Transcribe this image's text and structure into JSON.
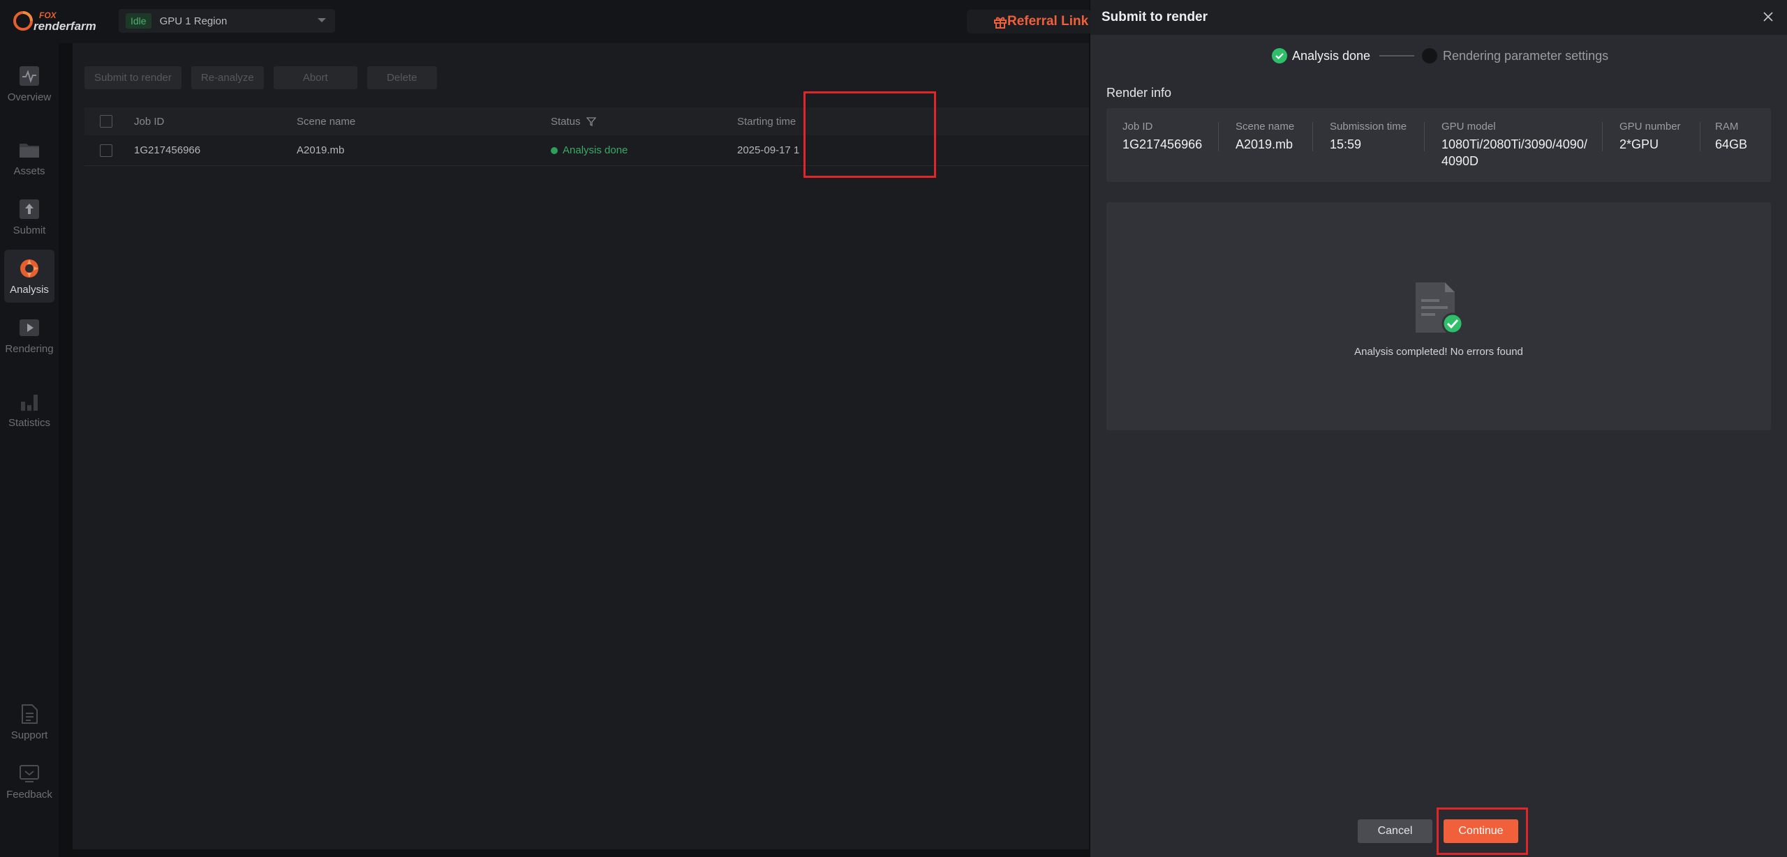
{
  "app": {
    "logo_top": "FOX",
    "logo_bottom": "renderfarm",
    "status_badge": "Idle",
    "region": "GPU 1 Region",
    "referral_label": "Referral Link"
  },
  "nav": {
    "items": [
      {
        "label": "Overview",
        "icon": "activity-icon"
      },
      {
        "label": "Assets",
        "icon": "folder-icon"
      },
      {
        "label": "Submit",
        "icon": "upload-icon"
      },
      {
        "label": "Analysis",
        "icon": "analysis-icon"
      },
      {
        "label": "Rendering",
        "icon": "play-icon"
      },
      {
        "label": "Statistics",
        "icon": "bar-chart-icon"
      }
    ],
    "bottom_items": [
      {
        "label": "Support",
        "icon": "document-icon"
      },
      {
        "label": "Feedback",
        "icon": "feedback-icon"
      }
    ]
  },
  "toolbar": {
    "submit_label": "Submit to render",
    "reanalyze_label": "Re-analyze",
    "abort_label": "Abort",
    "delete_label": "Delete"
  },
  "table": {
    "headers": {
      "job_id": "Job ID",
      "scene_name": "Scene name",
      "status": "Status",
      "starting_time": "Starting time"
    },
    "rows": [
      {
        "job_id": "1G217456966",
        "scene_name": "A2019.mb",
        "status": "Analysis done",
        "starting_time": "2025-09-17 1"
      }
    ]
  },
  "modal": {
    "title": "Submit to render",
    "steps": [
      {
        "label": "Analysis done",
        "state": "done"
      },
      {
        "label": "Rendering parameter settings",
        "state": "pending"
      }
    ],
    "render_info_title": "Render info",
    "info": {
      "job_id_label": "Job ID",
      "job_id": "1G217456966",
      "scene_name_label": "Scene name",
      "scene_name": "A2019.mb",
      "submission_time_label": "Submission time",
      "submission_time": "15:59",
      "gpu_model_label": "GPU model",
      "gpu_model_line1": "1080Ti/2080Ti/3090/4090/",
      "gpu_model_line2": "4090D",
      "gpu_number_label": "GPU number",
      "gpu_number": "2*GPU",
      "ram_label": "RAM",
      "ram": "64GB"
    },
    "result_text": "Analysis completed! No errors found",
    "cancel_label": "Cancel",
    "continue_label": "Continue"
  },
  "colors": {
    "accent": "#f0603a",
    "success": "#2f9e5a",
    "highlight": "#e0262b"
  }
}
